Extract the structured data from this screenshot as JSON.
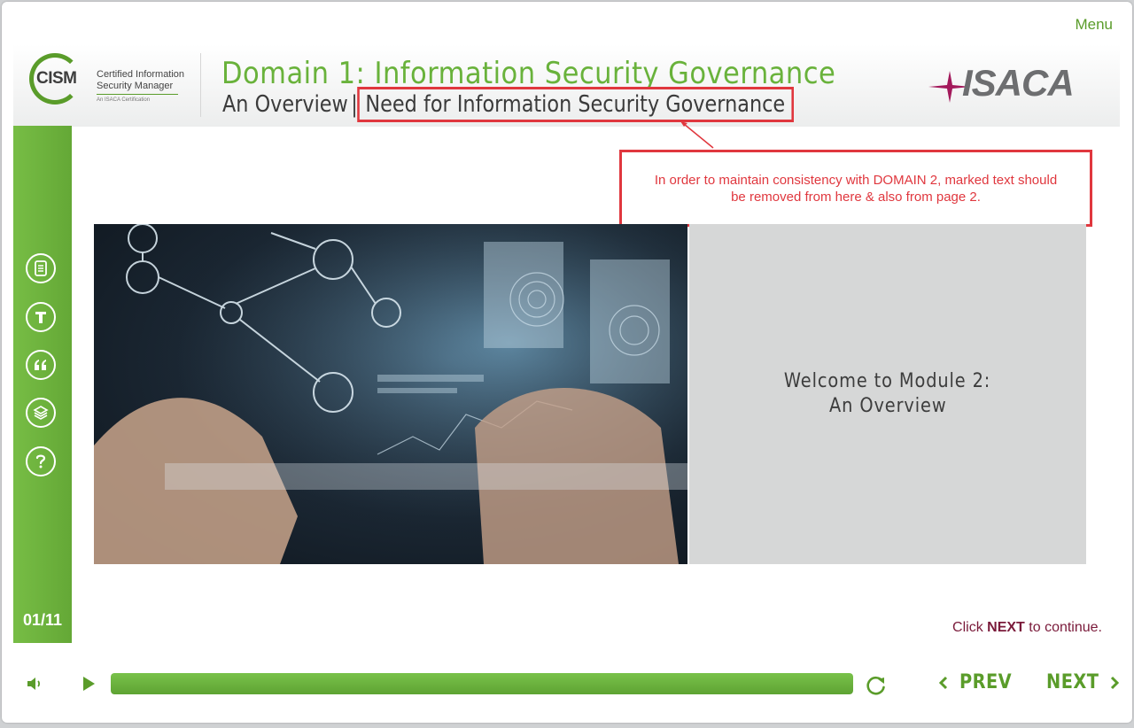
{
  "menu_label": "Menu",
  "header": {
    "logo_acronym": "CISM",
    "logo_line1": "Certified Information",
    "logo_line2": "Security Manager",
    "logo_tagline": "An ISACA Certification",
    "title": "Domain 1: Information Security Governance",
    "subtitle_prefix": "An Overview",
    "subtitle_separator": "|",
    "subtitle_marked": "Need for Information Security Governance",
    "brand": "ISACA"
  },
  "annotation": {
    "text": "In order to maintain consistency with DOMAIN 2, marked text should be removed from here & also from page 2."
  },
  "sidebar": {
    "icons": [
      "notes-icon",
      "transcript-icon",
      "quote-icon",
      "layers-icon",
      "help-icon"
    ],
    "page_counter": "01/11"
  },
  "welcome": {
    "line1": "Welcome to Module 2:",
    "line2": "An Overview"
  },
  "hint": {
    "prefix": "Click ",
    "emphasis": "NEXT",
    "suffix": " to continue."
  },
  "controls": {
    "progress": 1.0,
    "prev_label": "PREV",
    "next_label": "NEXT"
  },
  "colors": {
    "accent_green": "#69b23b",
    "annotation_red": "#e0373e",
    "hint_color": "#7a1a3a"
  }
}
